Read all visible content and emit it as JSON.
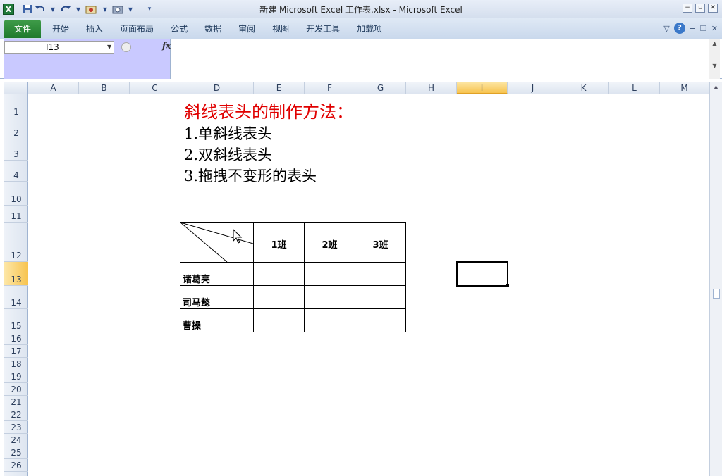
{
  "window": {
    "title": "新建 Microsoft Excel 工作表.xlsx  -  Microsoft Excel",
    "logo": "X",
    "controls": {
      "minimize": "−",
      "restore": "▫",
      "close": "✕"
    }
  },
  "quick_access": {
    "save_icon": "save-icon",
    "undo_icon": "undo-icon",
    "redo_icon": "redo-icon"
  },
  "ribbon": {
    "tabs": [
      {
        "label": "文件",
        "active": true
      },
      {
        "label": "开始"
      },
      {
        "label": "插入"
      },
      {
        "label": "页面布局"
      },
      {
        "label": "公式"
      },
      {
        "label": "数据"
      },
      {
        "label": "审阅"
      },
      {
        "label": "视图"
      },
      {
        "label": "开发工具"
      },
      {
        "label": "加载项"
      }
    ],
    "help": "?"
  },
  "formula_bar": {
    "name_box": "I13",
    "fx_label": "fx",
    "content": ""
  },
  "columns": [
    "A",
    "B",
    "C",
    "D",
    "E",
    "F",
    "G",
    "H",
    "I",
    "J",
    "K",
    "L",
    "M"
  ],
  "selected_column": "I",
  "rows": [
    "1",
    "2",
    "3",
    "4",
    "10",
    "11",
    "12",
    "13",
    "14",
    "15",
    "16",
    "17",
    "18",
    "19",
    "20",
    "21",
    "22",
    "23",
    "24",
    "25",
    "26"
  ],
  "selected_row": "13",
  "sheet": {
    "title": "斜线表头的制作方法：",
    "items": [
      "1.单斜线表头",
      "2.双斜线表头",
      "3.拖拽不变形的表头"
    ],
    "table": {
      "headers": [
        "1班",
        "2班",
        "3班"
      ],
      "row_labels": [
        "诸葛亮",
        "司马懿",
        "曹操"
      ]
    }
  },
  "colors": {
    "title_red": "#e00000",
    "file_tab_green": "#1f7a2c",
    "selection_gold": "#f7c34e"
  }
}
